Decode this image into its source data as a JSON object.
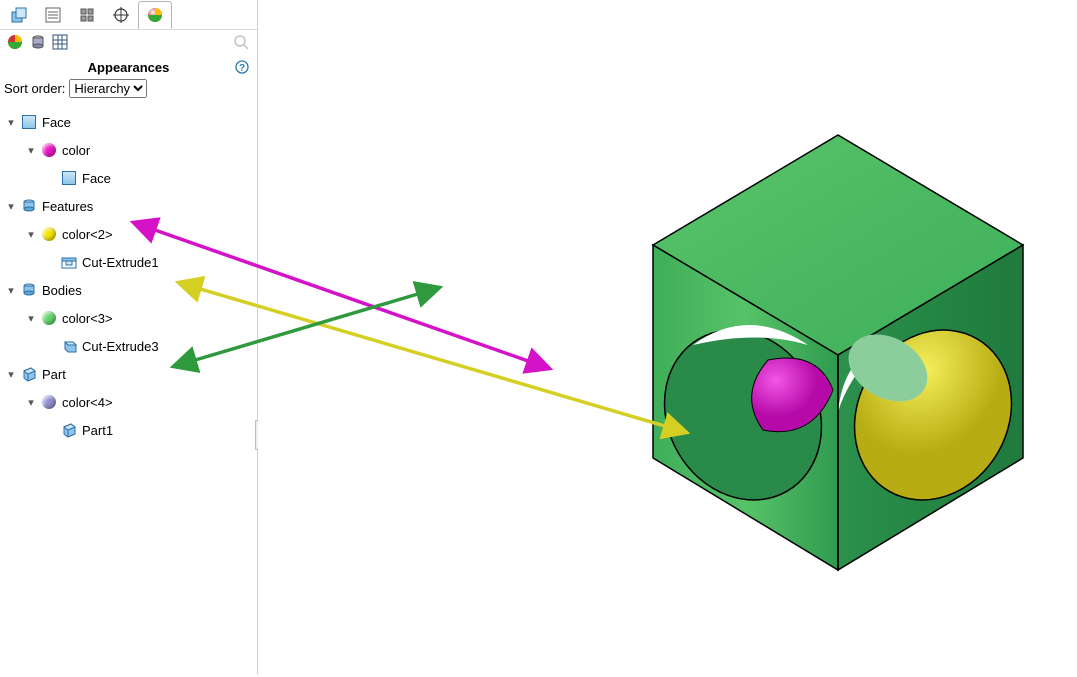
{
  "panel": {
    "title": "Appearances",
    "sort_label": "Sort order:",
    "sort_value": "Hierarchy",
    "sort_options": [
      "Hierarchy"
    ]
  },
  "tree": {
    "face": {
      "label": "Face",
      "color": {
        "label": "color",
        "swatch": "#e815c4"
      },
      "child": {
        "label": "Face"
      }
    },
    "features": {
      "label": "Features",
      "color": {
        "label": "color<2>",
        "swatch": "#f4e400"
      },
      "child": {
        "label": "Cut-Extrude1"
      }
    },
    "bodies": {
      "label": "Bodies",
      "color": {
        "label": "color<3>",
        "swatch": "#63d46a"
      },
      "child": {
        "label": "Cut-Extrude3"
      }
    },
    "part": {
      "label": "Part",
      "color": {
        "label": "color<4>",
        "swatch": "#8f8fcf"
      },
      "child": {
        "label": "Part1"
      }
    }
  },
  "colors": {
    "cube_green_light": "#58c26a",
    "cube_green_dark": "#2f9a55",
    "cube_top": "#4dbc66",
    "magenta": "#d413c8",
    "yellow": "#d5cf24",
    "arrow_green": "#2f9a3d"
  }
}
